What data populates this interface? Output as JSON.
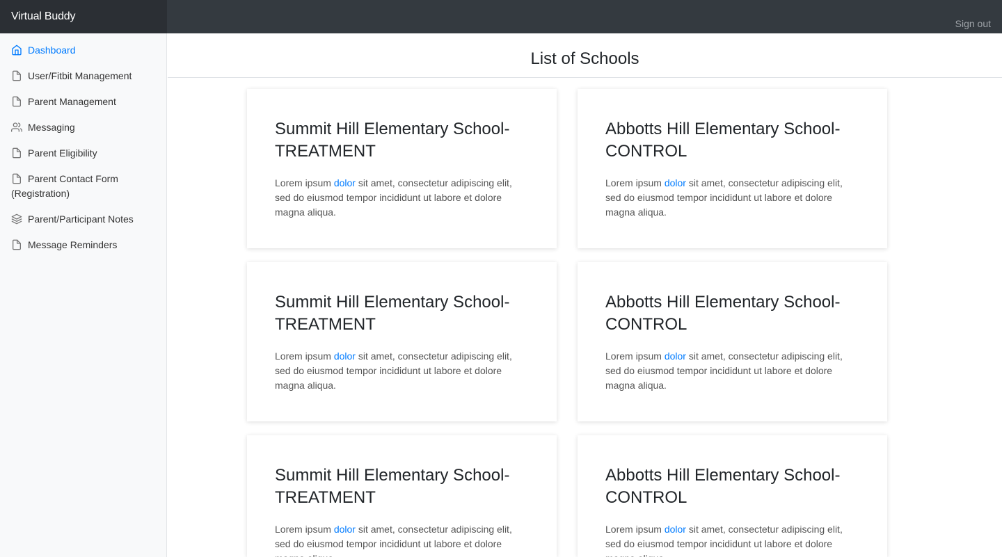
{
  "app": {
    "brand": "Virtual Buddy",
    "sign_out": "Sign out"
  },
  "sidebar": {
    "items": [
      {
        "label": "Dashboard",
        "icon": "home-icon",
        "active": true
      },
      {
        "label": "User/Fitbit Management",
        "icon": "file-icon"
      },
      {
        "label": "Parent Management",
        "icon": "file-icon"
      },
      {
        "label": "Messaging",
        "icon": "users-icon"
      },
      {
        "label": "Parent Eligibility",
        "icon": "file-icon"
      },
      {
        "label": "Parent Contact Form (Registration)",
        "icon": "file-icon"
      },
      {
        "label": "Parent/Participant Notes",
        "icon": "layers-icon"
      },
      {
        "label": "Message Reminders",
        "icon": "file-icon"
      }
    ]
  },
  "main": {
    "title": "List of Schools",
    "cards": [
      {
        "title": "Summit Hill Elementary School-TREATMENT",
        "text_before": "Lorem ipsum ",
        "link": "dolor",
        "text_after": " sit amet, consectetur adipiscing elit, sed do eiusmod tempor incididunt ut labore et dolore magna aliqua."
      },
      {
        "title": "Abbotts Hill Elementary School-CONTROL",
        "text_before": "Lorem ipsum ",
        "link": "dolor",
        "text_after": " sit amet, consectetur adipiscing elit, sed do eiusmod tempor incididunt ut labore et dolore magna aliqua."
      },
      {
        "title": "Summit Hill Elementary School-TREATMENT",
        "text_before": "Lorem ipsum ",
        "link": "dolor",
        "text_after": " sit amet, consectetur adipiscing elit, sed do eiusmod tempor incididunt ut labore et dolore magna aliqua."
      },
      {
        "title": "Abbotts Hill Elementary School-CONTROL",
        "text_before": "Lorem ipsum ",
        "link": "dolor",
        "text_after": " sit amet, consectetur adipiscing elit, sed do eiusmod tempor incididunt ut labore et dolore magna aliqua."
      },
      {
        "title": "Summit Hill Elementary School-TREATMENT",
        "text_before": "Lorem ipsum ",
        "link": "dolor",
        "text_after": " sit amet, consectetur adipiscing elit, sed do eiusmod tempor incididunt ut labore et dolore magna aliqua."
      },
      {
        "title": "Abbotts Hill Elementary School-CONTROL",
        "text_before": "Lorem ipsum ",
        "link": "dolor",
        "text_after": " sit amet, consectetur adipiscing elit, sed do eiusmod tempor incididunt ut labore et dolore magna aliqua."
      }
    ]
  },
  "colors": {
    "accent": "#007bff",
    "topbar": "#343a40",
    "brand_bg": "#2b2f34",
    "sidebar_bg": "#f8f9fa"
  }
}
